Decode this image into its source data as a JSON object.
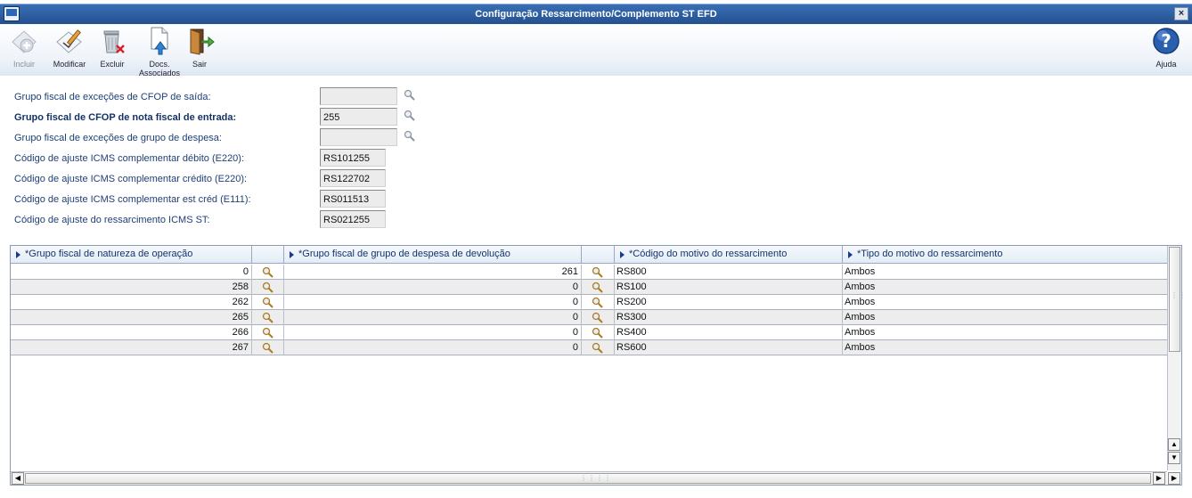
{
  "window": {
    "title": "Configuração Ressarcimento/Complemento ST EFD",
    "close_label": "×"
  },
  "toolbar": {
    "incluir": "Incluir",
    "modificar": "Modificar",
    "excluir": "Excluir",
    "docs_line1": "Docs.",
    "docs_line2": "Associados",
    "sair": "Sair",
    "ajuda": "Ajuda"
  },
  "form": {
    "fields": [
      {
        "label": "Grupo fiscal de exceções de CFOP de saída:",
        "value": ""
      },
      {
        "label": "Grupo fiscal de CFOP de nota fiscal de entrada:",
        "value": "255"
      },
      {
        "label": "Grupo fiscal de exceções de grupo de despesa:",
        "value": ""
      },
      {
        "label": "Código de ajuste ICMS complementar débito (E220):",
        "value": "RS101255"
      },
      {
        "label": "Código de ajuste ICMS complementar crédito (E220):",
        "value": "RS122702"
      },
      {
        "label": "Código de ajuste ICMS complementar est créd (E111):",
        "value": "RS011513"
      },
      {
        "label": "Código de ajuste do ressarcimento ICMS ST:",
        "value": "RS021255"
      }
    ]
  },
  "grid": {
    "headers": [
      "*Grupo fiscal de natureza de operação",
      "*Grupo fiscal de grupo de despesa de devolução",
      "*Código do motivo do ressarcimento",
      "*Tipo do motivo do ressarcimento"
    ],
    "rows": [
      [
        "0",
        "261",
        "RS800",
        "Ambos"
      ],
      [
        "258",
        "0",
        "RS100",
        "Ambos"
      ],
      [
        "262",
        "0",
        "RS200",
        "Ambos"
      ],
      [
        "265",
        "0",
        "RS300",
        "Ambos"
      ],
      [
        "266",
        "0",
        "RS400",
        "Ambos"
      ],
      [
        "267",
        "0",
        "RS600",
        "Ambos"
      ]
    ]
  },
  "icons": {
    "search": "magnifier-icon",
    "accent": "#2b66b8"
  }
}
